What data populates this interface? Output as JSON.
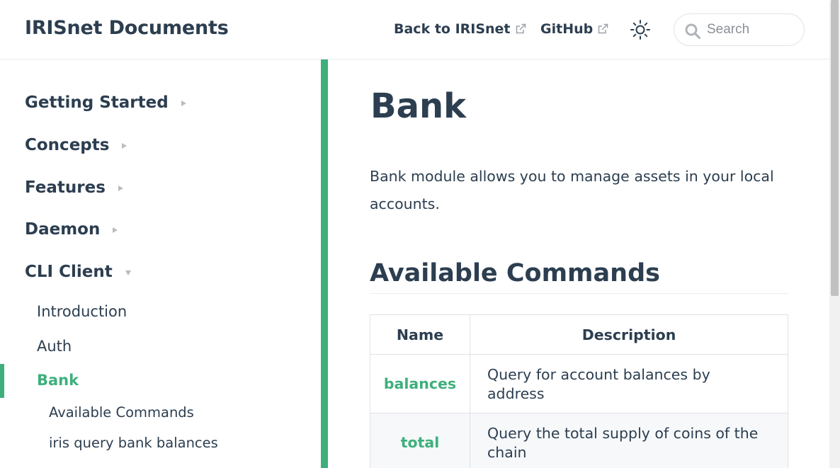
{
  "navbar": {
    "site_name": "IRISnet Documents",
    "links": [
      {
        "label": "Back to IRISnet",
        "icon": "external-link-icon"
      },
      {
        "label": "GitHub",
        "icon": "external-link-icon"
      }
    ],
    "theme_icon": "sun-icon",
    "search": {
      "placeholder": "Search",
      "value": "",
      "icon": "search-icon"
    }
  },
  "sidebar": {
    "sections": [
      {
        "label": "Getting Started",
        "expanded": false
      },
      {
        "label": "Concepts",
        "expanded": false
      },
      {
        "label": "Features",
        "expanded": false
      },
      {
        "label": "Daemon",
        "expanded": false
      },
      {
        "label": "CLI Client",
        "expanded": true
      }
    ],
    "cli_items": [
      {
        "label": "Introduction"
      },
      {
        "label": "Auth"
      },
      {
        "label": "Bank",
        "active": true
      }
    ],
    "sub_items": [
      {
        "label": "Available Commands"
      },
      {
        "label": "iris query bank balances"
      }
    ]
  },
  "content": {
    "title": "Bank",
    "intro": "Bank module allows you to manage assets in your local accounts.",
    "section_heading": "Available Commands",
    "table": {
      "headers": [
        "Name",
        "Description"
      ],
      "rows": [
        {
          "name": "balances",
          "description": "Query for account balances by address"
        },
        {
          "name": "total",
          "description": "Query the total supply of coins of the chain"
        }
      ]
    }
  },
  "colors": {
    "accent": "#3eaf7c",
    "text": "#2c3e50",
    "border": "#eaecef"
  }
}
